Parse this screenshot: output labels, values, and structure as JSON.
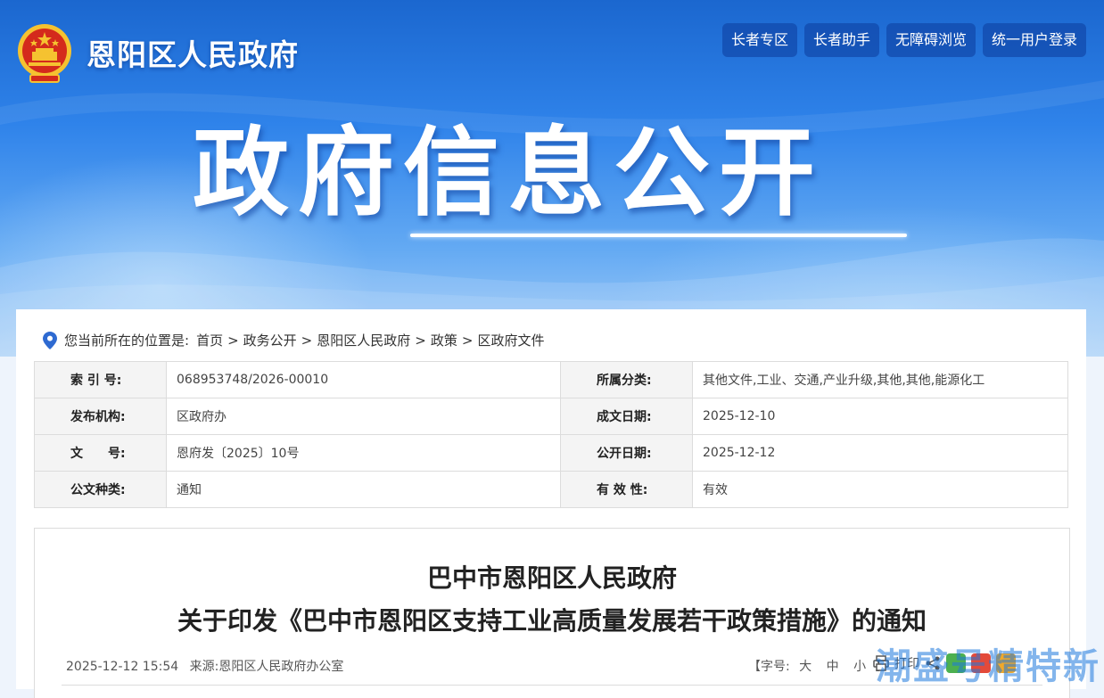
{
  "header": {
    "site_name": "恩阳区人民政府",
    "buttons": [
      "长者专区",
      "长者助手",
      "无障碍浏览",
      "统一用户登录"
    ],
    "hero_title": "政府信息公开"
  },
  "breadcrumb": {
    "prefix": "您当前所在的位置是:",
    "items": [
      "首页",
      "政务公开",
      "恩阳区人民政府",
      "政策",
      "区政府文件"
    ]
  },
  "meta": {
    "rows": [
      {
        "k1": "索 引 号:",
        "v1": "068953748/2026-00010",
        "k2": "所属分类:",
        "v2": "其他文件,工业、交通,产业升级,其他,其他,能源化工"
      },
      {
        "k1": "发布机构:",
        "v1": "区政府办",
        "k2": "成文日期:",
        "v2": "2025-12-10"
      },
      {
        "k1": "文　　号:",
        "v1": "恩府发〔2025〕10号",
        "k2": "公开日期:",
        "v2": "2025-12-12"
      },
      {
        "k1": "公文种类:",
        "v1": "通知",
        "k2": "有 效 性:",
        "v2": "有效"
      }
    ]
  },
  "article": {
    "title_line1": "巴中市恩阳区人民政府",
    "title_line2": "关于印发《巴中市恩阳区支持工业高质量发展若干政策措施》的通知",
    "datetime": "2025-12-12 15:54",
    "source": "来源:恩阳区人民政府办公室",
    "fontsize_label": "【字号:",
    "fontsize_options": [
      "大",
      "中",
      "小"
    ],
    "fontsize_end": "】",
    "print_label": "打印"
  },
  "watermark": "潮盛号精特新",
  "colors": {
    "brand_blue": "#1b67cf",
    "button_bg": "#1048aa",
    "emblem_red": "#d42a1c",
    "emblem_gold": "#f5c230"
  }
}
